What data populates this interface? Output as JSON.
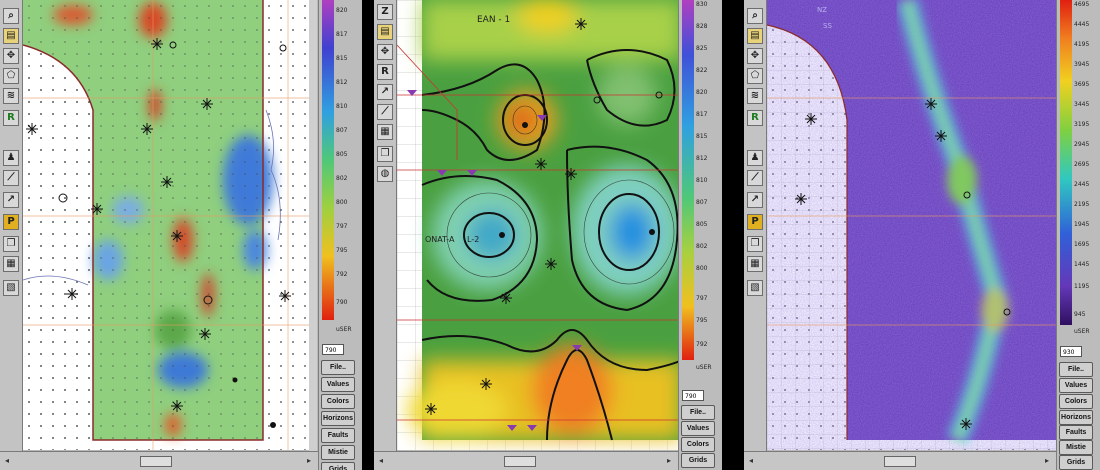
{
  "panels": [
    {
      "id": "left",
      "scale_labels": [
        "820",
        "817",
        "815",
        "812",
        "810",
        "807",
        "805",
        "802",
        "800",
        "797",
        "795",
        "792",
        "790"
      ],
      "units": "uSER",
      "value_box": "790",
      "buttons": [
        "File..",
        "Values",
        "Colors",
        "Horizons",
        "Faults",
        "Mistie",
        "Grids"
      ]
    },
    {
      "id": "middle",
      "scale_labels": [
        "830",
        "828",
        "825",
        "822",
        "820",
        "817",
        "815",
        "812",
        "810",
        "807",
        "805",
        "802",
        "800",
        "797",
        "795",
        "792"
      ],
      "units": "uSER",
      "value_box": "790",
      "buttons": [
        "File..",
        "Values",
        "Colors",
        "Grids"
      ],
      "map_labels": [
        "EAN - 1",
        "ONAT-A",
        "L-2"
      ]
    },
    {
      "id": "right",
      "scale_labels": [
        "4695",
        "4445",
        "4195",
        "3945",
        "3695",
        "3445",
        "3195",
        "2945",
        "2695",
        "2445",
        "2195",
        "1945",
        "1695",
        "1445",
        "1195",
        "945"
      ],
      "units": "uSER",
      "value_box": "930",
      "buttons": [
        "File..",
        "Values",
        "Colors",
        "Horizons",
        "Faults",
        "Mistie",
        "Grids"
      ]
    }
  ],
  "tool_icons": [
    "zoom-icon",
    "layers-icon",
    "pan-icon",
    "polygon-icon",
    "contour-icon",
    "r-icon",
    "well-icon",
    "fault-icon",
    "line-icon",
    "p-icon",
    "copy-icon",
    "print-icon",
    "color-icon"
  ]
}
